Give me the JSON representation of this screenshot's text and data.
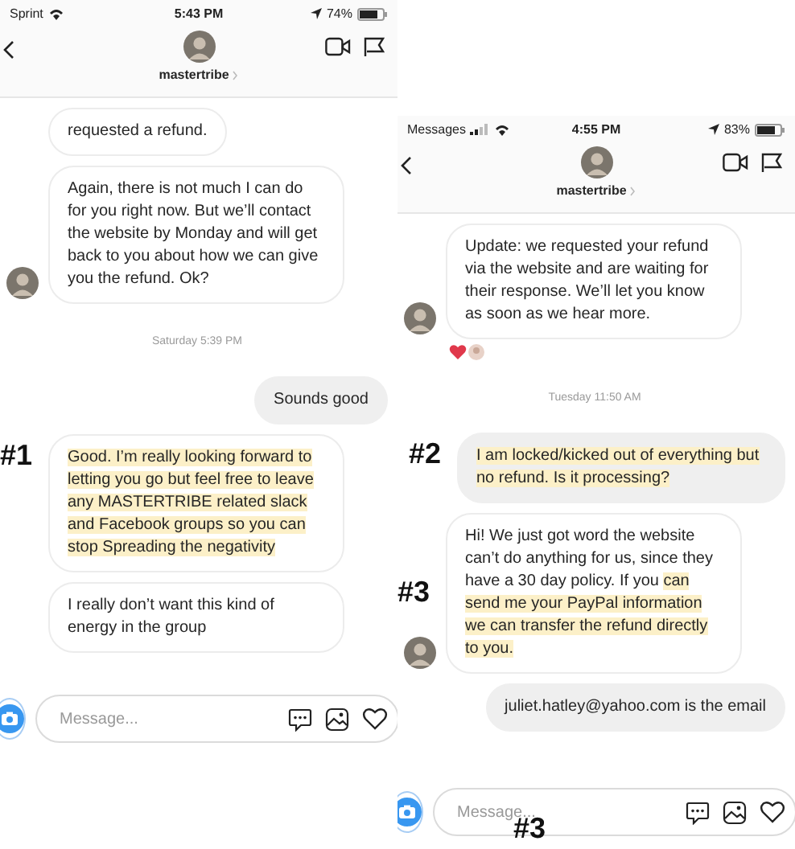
{
  "panels": [
    {
      "status_bar": {
        "carrier": "Sprint",
        "signal": false,
        "time": "5:43 PM",
        "battery": "74%"
      },
      "header": {
        "username": "mastertribe"
      },
      "messages": [
        {
          "kind": "incoming",
          "parts": [
            {
              "text": "requested a refund.",
              "highlighted": false
            }
          ]
        },
        {
          "kind": "incoming_avatar",
          "parts": [
            {
              "text": "Again, there is not much I can do for you right now. But we’ll contact the website by Monday and will get back to you about how we can give you the refund. Ok?",
              "highlighted": false
            }
          ]
        },
        {
          "kind": "timestamp",
          "text": "Saturday 5:39 PM"
        },
        {
          "kind": "outgoing",
          "parts": [
            {
              "text": "Sounds good",
              "highlighted": false
            }
          ]
        },
        {
          "kind": "incoming",
          "annotation": "#1",
          "parts": [
            {
              "text": "Good. I’m really looking forward to letting you go but feel free to leave any MASTERTRIBE related slack and Facebook groups so you can stop Spreading the negativity",
              "highlighted": true
            }
          ]
        },
        {
          "kind": "incoming",
          "parts": [
            {
              "text": "I really don’t want this kind of energy in the group",
              "highlighted": false
            }
          ]
        }
      ],
      "composer": {
        "placeholder": "Message..."
      }
    },
    {
      "status_bar": {
        "carrier": "Messages",
        "signal": true,
        "time": "4:55 PM",
        "battery": "83%"
      },
      "header": {
        "username": "mastertribe"
      },
      "messages": [
        {
          "kind": "incoming_avatar",
          "reactions": [
            {
              "kind": "heart"
            },
            {
              "kind": "avatar"
            }
          ],
          "parts": [
            {
              "text": "Update: we requested your refund via the website and are waiting for their response. We’ll let you know as soon as we hear more.",
              "highlighted": false
            }
          ]
        },
        {
          "kind": "timestamp",
          "text": "Tuesday 11:50 AM"
        },
        {
          "kind": "outgoing",
          "annotation": "#2",
          "parts": [
            {
              "text": "I am locked/kicked out of everything but no refund. Is it processing?",
              "highlighted": true
            }
          ]
        },
        {
          "kind": "incoming_avatar",
          "annotation": "#3",
          "parts": [
            {
              "text": "Hi! We just got word the website can’t do anything for us, since they have a 30 day policy. If you ",
              "highlighted": false
            },
            {
              "text": "can send me your PayPal information we can transfer the refund directly to you.",
              "highlighted": true
            }
          ]
        },
        {
          "kind": "outgoing",
          "parts": [
            {
              "text": "juliet.hatley@yahoo.com is the email",
              "highlighted": false
            }
          ]
        }
      ],
      "composer": {
        "placeholder": "Message...",
        "annotation": "#3"
      }
    }
  ]
}
